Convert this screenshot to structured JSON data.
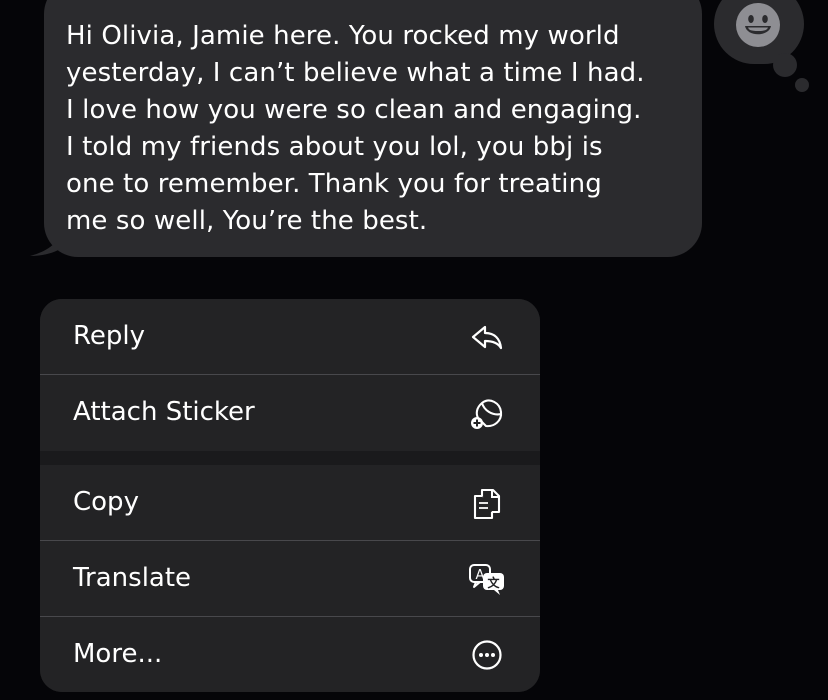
{
  "message": {
    "text": "Hi Olivia, Jamie here. You rocked my world\nyesterday, I can’t believe what a time I had.\nI love how you were so clean and engaging.\nI told my friends about you lol, you bbj is\none to remember. Thank you for treating\nme so well, You’re the best."
  },
  "tapback": {
    "icon": "smiley-face-icon"
  },
  "menu": {
    "items": [
      {
        "label": "Reply",
        "icon": "reply-arrow-icon"
      },
      {
        "label": "Attach Sticker",
        "icon": "sticker-add-icon"
      },
      {
        "label": "Copy",
        "icon": "copy-documents-icon"
      },
      {
        "label": "Translate",
        "icon": "translate-icon"
      },
      {
        "label": "More...",
        "icon": "ellipsis-circle-icon"
      }
    ]
  },
  "colors": {
    "background": "#050508",
    "bubble": "#2b2b2e",
    "menu": "#232325",
    "text": "#ffffff",
    "icon": "#ffffff"
  }
}
